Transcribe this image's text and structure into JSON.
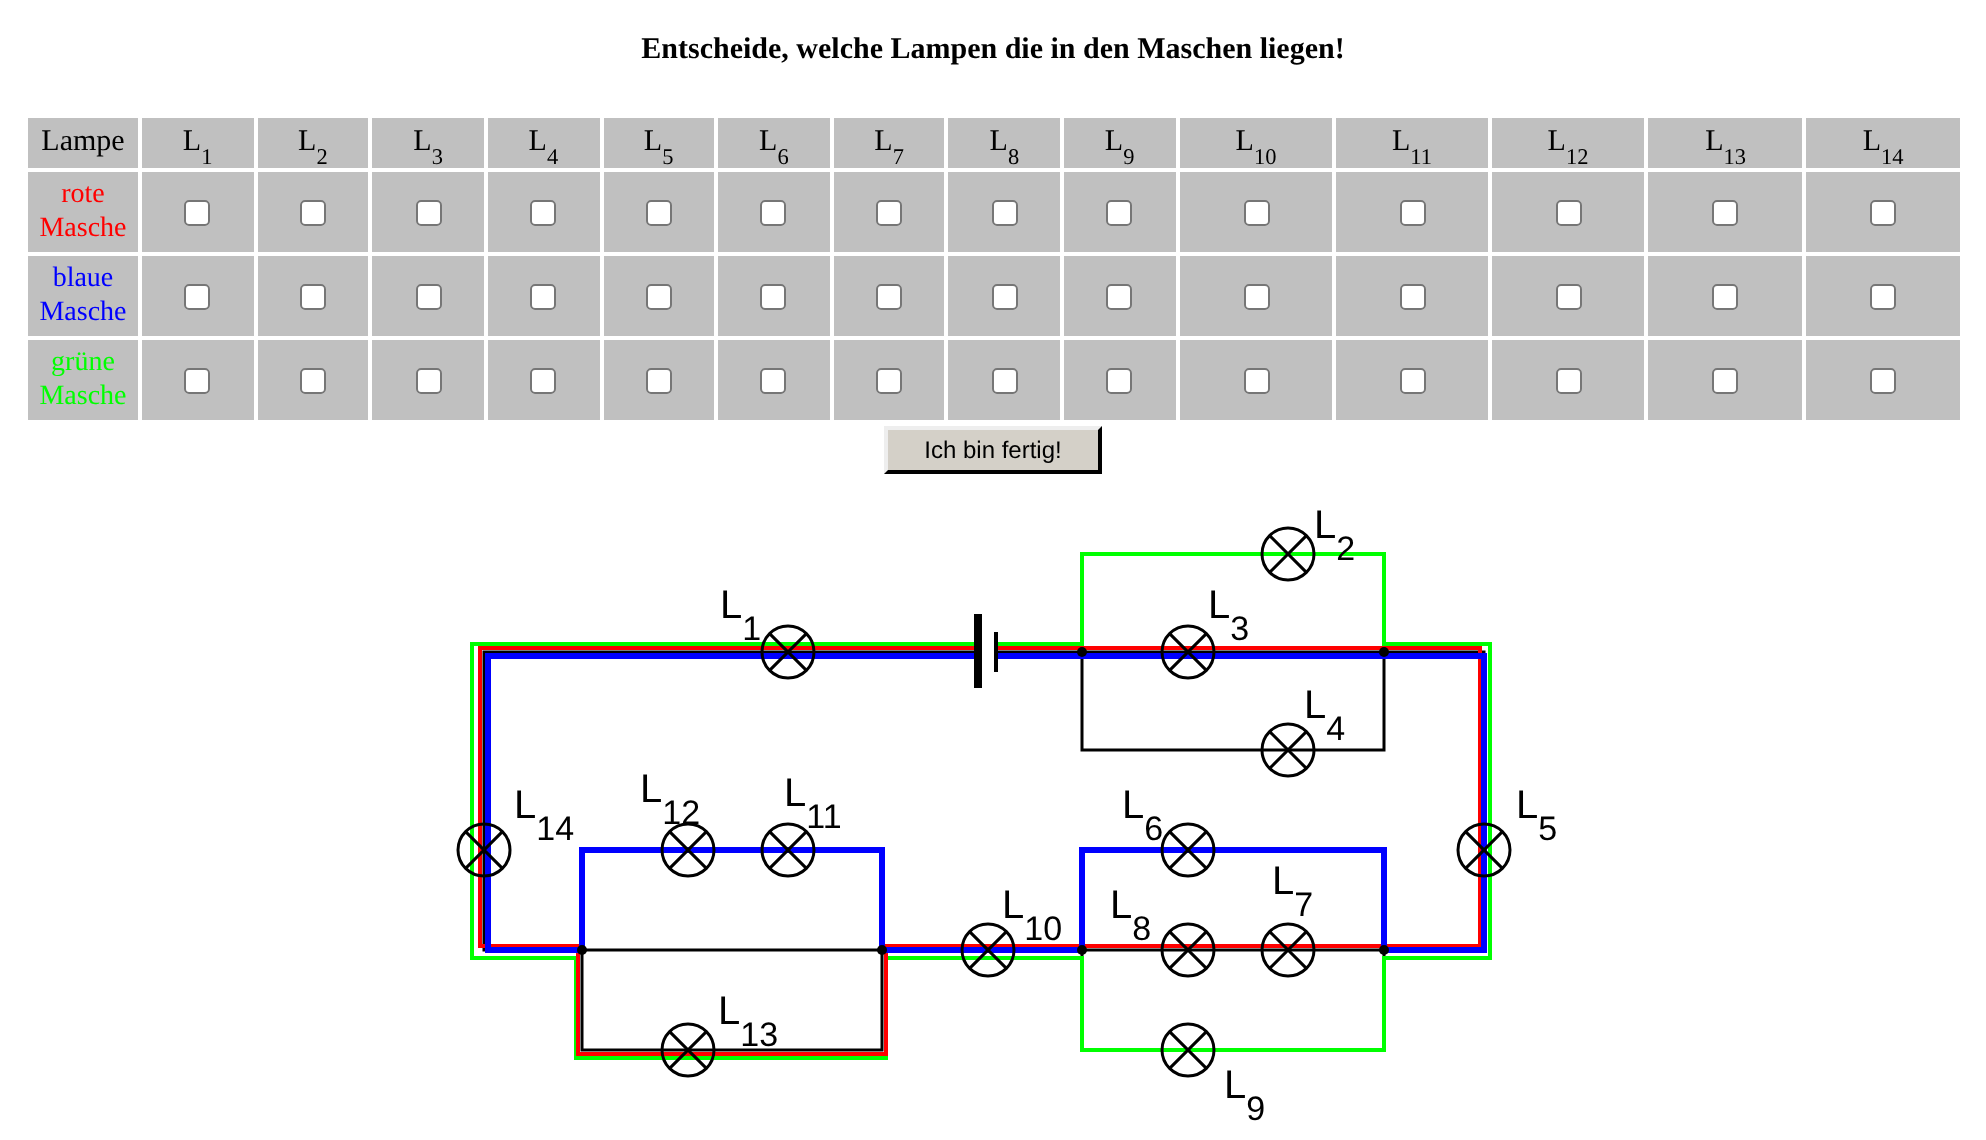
{
  "title": "Entscheide, welche Lampen die in den Maschen liegen!",
  "table": {
    "corner": "Lampe",
    "columns": [
      "L$_{1}$",
      "L$_{2}$",
      "L$_{3}$",
      "L$_{4}$",
      "L$_{5}$",
      "L$_{6}$",
      "L$_{7}$",
      "L$_{8}$",
      "L$_{9}$",
      "L$_{10}$",
      "L$_{11}$",
      "L$_{12}$",
      "L$_{13}$",
      "L$_{14}$"
    ],
    "rows": [
      {
        "label_lines": [
          "rote",
          "Masche"
        ],
        "color": "#ff0000",
        "checked": [
          false,
          false,
          false,
          false,
          false,
          false,
          false,
          false,
          false,
          false,
          false,
          false,
          false,
          false
        ]
      },
      {
        "label_lines": [
          "blaue",
          "Masche"
        ],
        "color": "#0000ff",
        "checked": [
          false,
          false,
          false,
          false,
          false,
          false,
          false,
          false,
          false,
          false,
          false,
          false,
          false,
          false
        ]
      },
      {
        "label_lines": [
          "grüne",
          "Masche"
        ],
        "color": "#00ff00",
        "checked": [
          false,
          false,
          false,
          false,
          false,
          false,
          false,
          false,
          false,
          false,
          false,
          false,
          false,
          false
        ]
      }
    ]
  },
  "button": "Ich bin fertig!",
  "circuit": {
    "lamps": [
      "L$_{2}$",
      "L$_{1}$",
      "L$_{3}$",
      "L$_{4}$",
      "L$_{14}$",
      "L$_{12}$",
      "L$_{11}$",
      "L$_{6}$",
      "L$_{5}$",
      "L$_{7}$",
      "L$_{10}$",
      "L$_{8}$",
      "L$_{13}$",
      "L$_{9}$"
    ],
    "meshes": [
      {
        "color": "#ff0000"
      },
      {
        "color": "#0000ff"
      },
      {
        "color": "#00ff00"
      }
    ]
  }
}
